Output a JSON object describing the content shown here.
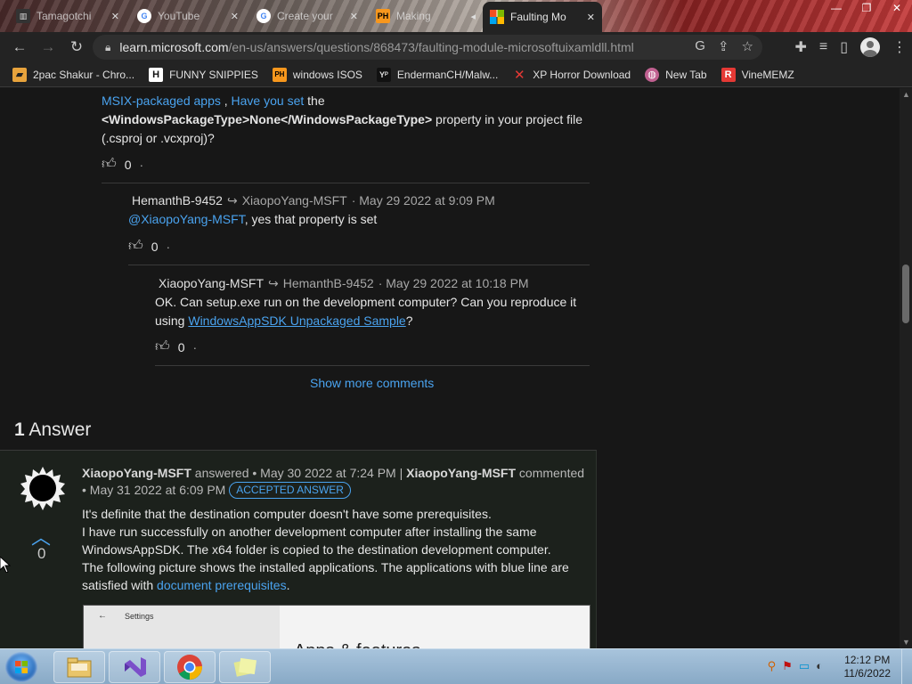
{
  "browser": {
    "tabs": [
      {
        "title": "Tamagotchi",
        "favicon": "tamagotchi-favicon",
        "active": false
      },
      {
        "title": "YouTube",
        "favicon": "google-favicon",
        "active": false
      },
      {
        "title": "Create your",
        "favicon": "google-favicon",
        "active": false
      },
      {
        "title": "Making",
        "favicon": "ph-favicon",
        "active": false
      },
      {
        "title": "Faulting Mo",
        "favicon": "microsoft-favicon",
        "active": true
      }
    ],
    "url_host": "learn.microsoft.com",
    "url_path": "/en-us/answers/questions/868473/faulting-module-microsoftuixamldll.html",
    "bookmarks": [
      {
        "label": "2pac Shakur - Chro...",
        "icon": "bookmark-icon",
        "color": "#e8a33c"
      },
      {
        "label": "FUNNY SNIPPIES",
        "icon": "h-icon",
        "color": "#ffffff"
      },
      {
        "label": "windows ISOS",
        "icon": "ph-icon",
        "color": "#f7971d"
      },
      {
        "label": "EndermanCH/Malw...",
        "icon": "yp-icon",
        "color": "#ffffff"
      },
      {
        "label": "XP Horror Download",
        "icon": "x-icon",
        "color": "#e53935"
      },
      {
        "label": "New Tab",
        "icon": "globe-icon",
        "color": "#c06090"
      },
      {
        "label": "VineMEMZ",
        "icon": "r-icon",
        "color": "#e53935"
      }
    ]
  },
  "comments": {
    "c0": {
      "link1": "MSIX-packaged apps",
      "sep": " , ",
      "link2": "Have you set",
      "text1": " the",
      "code": "<WindowsPackageType>None</WindowsPackageType>",
      "text2": " property in your project file",
      "text3": "(.csproj or .vcxproj)?",
      "votes": "0",
      "dot": "·"
    },
    "c1": {
      "author": "HemanthB-9452",
      "reply_to": "XiaopoYang-MSFT",
      "date": "· May 29 2022 at 9:09 PM",
      "mention": "@XiaopoYang-MSFT",
      "text": ", yes that property is set",
      "votes": "0",
      "dot": "·"
    },
    "c2": {
      "author": "XiaopoYang-MSFT",
      "reply_to": "HemanthB-9452",
      "date": "· May 29 2022 at 10:18 PM",
      "line1": "OK. Can setup.exe run on the development computer? Can you reproduce it",
      "line2_pre": "using ",
      "link": "WindowsAppSDK Unpackaged Sample",
      "line2_post": "?",
      "votes": "0",
      "dot": "·"
    },
    "show_more": "Show more comments"
  },
  "answers": {
    "count": "1",
    "label": "Answer",
    "author": "XiaopoYang-MSFT",
    "answered": "answered • May 30 2022 at 7:24 PM |",
    "commenter": "XiaopoYang-MSFT",
    "commented": "commented •",
    "date2": "May 31 2022 at 6:09 PM",
    "badge": "ACCEPTED ANSWER",
    "votes": "0",
    "body": [
      "It's definite that the destination computer doesn't have some prerequisites.",
      "I have run successfully on another development computer after installing the same",
      "WindowsAppSDK. The x64 folder is copied to the destination development computer.",
      "The following picture shows the installed applications. The applications with blue line are"
    ],
    "body_last_pre": "satisfied with ",
    "body_last_link": "document prerequisites",
    "body_last_post": ".",
    "screenshot": {
      "back": "←",
      "title": "Settings",
      "heading": "Apps & features"
    }
  },
  "taskbar": {
    "time": "12:12 PM",
    "date": "11/6/2022"
  }
}
